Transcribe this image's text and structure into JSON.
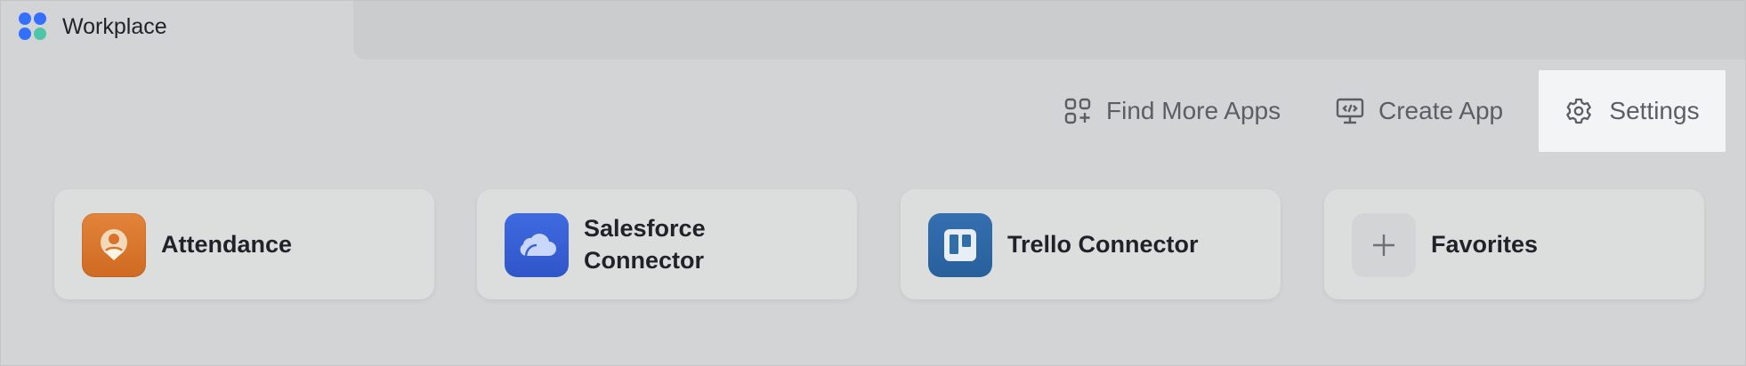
{
  "window": {
    "tab_title": "Workplace",
    "logo_colors": [
      "#3370ff",
      "#3370ff",
      "#3370ff",
      "#4cc5a9"
    ]
  },
  "toolbar": {
    "find_more_apps": "Find More Apps",
    "create_app": "Create App",
    "settings": "Settings"
  },
  "apps": [
    {
      "label": "Attendance",
      "icon": "attendance-icon",
      "color": "#e07a2e"
    },
    {
      "label": "Salesforce Connector",
      "icon": "cloud-icon",
      "color": "#3a62d6"
    },
    {
      "label": "Trello Connector",
      "icon": "trello-icon",
      "color": "#2f6ea8"
    },
    {
      "label": "Favorites",
      "icon": "plus-icon",
      "color": "#d3d4d5"
    }
  ]
}
